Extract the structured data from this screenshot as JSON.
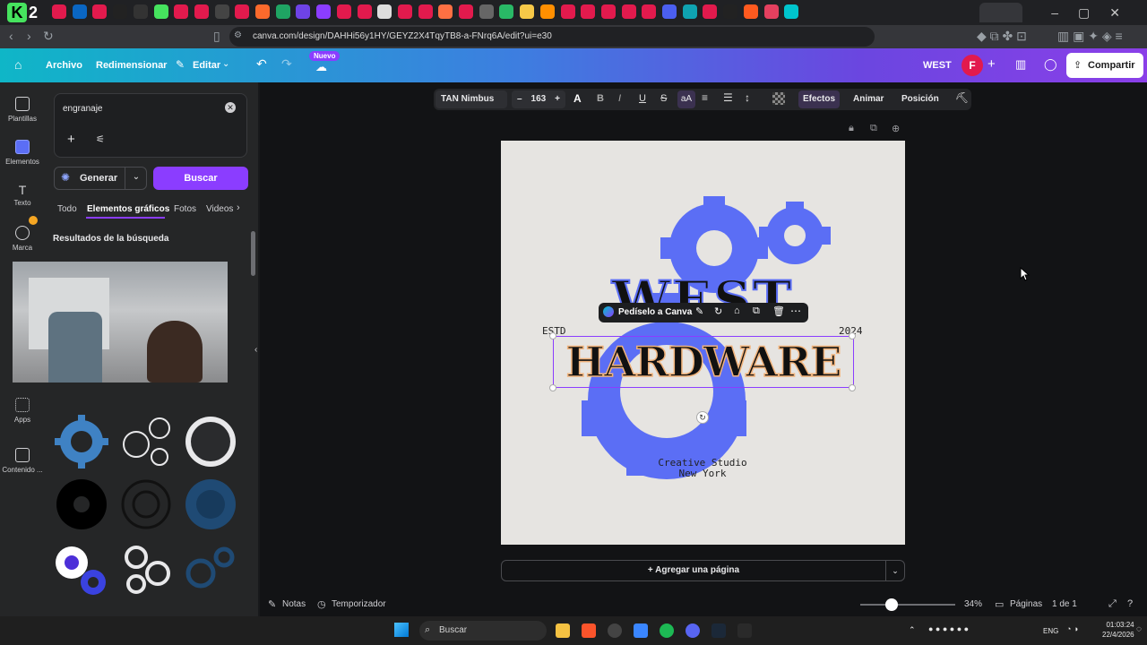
{
  "browser": {
    "url": "canva.com/design/DAHHi56y1HY/GEYZ2X4TqyTB8-a-FNrq6A/edit?ui=e30",
    "logo_text": "2"
  },
  "header": {
    "archivo": "Archivo",
    "redimensionar": "Redimensionar",
    "editar": "Editar",
    "nuevo_badge": "Nuevo",
    "project_name": "WEST",
    "avatar_initial": "F",
    "share": "Compartir"
  },
  "rail": {
    "items": [
      "Plantillas",
      "Elementos",
      "Texto",
      "Marca",
      "Apps",
      "Contenido ..."
    ]
  },
  "panel": {
    "search_value": "engranaje",
    "generar": "Generar",
    "buscar": "Buscar",
    "tabs": [
      "Todo",
      "Elementos gráficos",
      "Fotos",
      "Videos"
    ],
    "results_title": "Resultados de la búsqueda"
  },
  "toolbar": {
    "font": "TAN Nimbus",
    "size": "163",
    "efectos": "Efectos",
    "animar": "Animar",
    "posicion": "Posición"
  },
  "design": {
    "estd": "ESTD",
    "year": "2024",
    "word1": "WEST",
    "word2": "HARDWARE",
    "studio_line1": "Creative Studio",
    "studio_line2": "New York",
    "gear_color": "#5b6ef5"
  },
  "context_menu": {
    "ask_canva": "Pedíselo a Canva"
  },
  "footer": {
    "add_page": "+ Agregar una página",
    "notas": "Notas",
    "temporizador": "Temporizador",
    "zoom": "34%",
    "paginas": "Páginas",
    "page_count": "1 de 1"
  },
  "taskbar": {
    "search": "Buscar",
    "lang": "ENG",
    "time": "01:03:24",
    "date": "22/4/2026"
  }
}
